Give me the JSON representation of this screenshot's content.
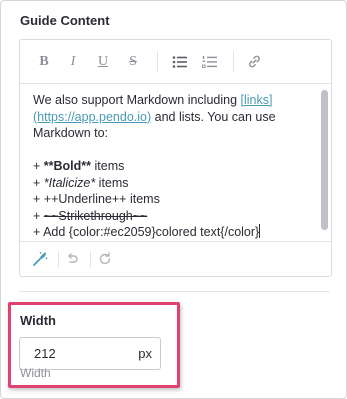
{
  "section": {
    "title": "Guide Content"
  },
  "toolbar": {
    "bold": "B",
    "italic": "I",
    "underline": "U",
    "strike": "S"
  },
  "editor": {
    "line1": "We also support Markdown including ",
    "line1_link": "[links]",
    "line2_link": "(https://app.pendo.io)",
    "line2_rest": " and lists. You can use",
    "line3": "Markdown to:",
    "item1_prefix": "+ ",
    "item1_bold": "**Bold**",
    "item1_suffix": " items",
    "item2_prefix": "+ ",
    "item2_italic": "*Italicize*",
    "item2_suffix": " items",
    "item3": "+ ++Underline++ items",
    "item4_prefix": "+ ",
    "item4_strike": "~~Strikethrough~~",
    "item5": "+ Add {color:#ec2059}colored text{/color}"
  },
  "width": {
    "title": "Width",
    "value": "212",
    "unit": "px",
    "sublabel": "Width"
  },
  "colors": {
    "highlight": "#e0416f",
    "link": "#4a9bb5",
    "magic_wand": "#4a9bb5"
  }
}
